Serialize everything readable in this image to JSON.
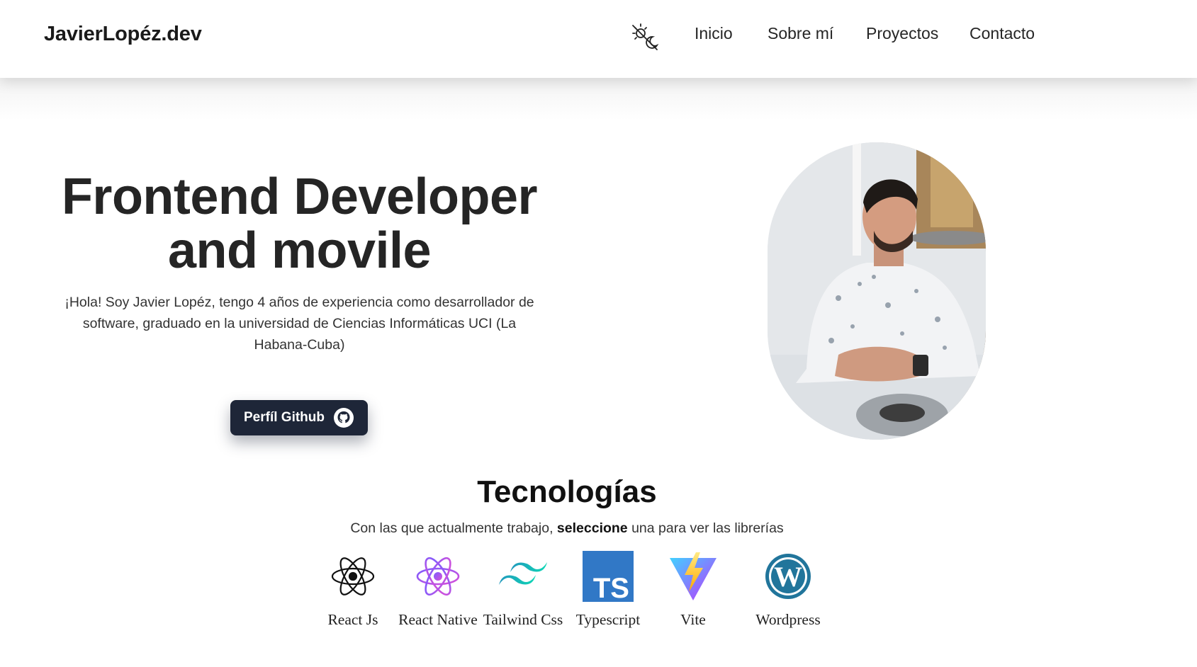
{
  "header": {
    "logo": "JavierLopéz.dev",
    "nav": [
      {
        "label": "Inicio"
      },
      {
        "label": "Sobre mí"
      },
      {
        "label": "Proyectos"
      },
      {
        "label": "Contacto"
      }
    ]
  },
  "hero": {
    "title_line1": "Frontend Developer",
    "title_line2": "and movile",
    "description": "¡Hola! Soy Javier Lopéz, tengo 4 años de experiencia como desarrollador de software, graduado en la universidad de Ciencias Informáticas UCI (La Habana-Cuba)",
    "github_button": "Perfíl Github"
  },
  "technologies": {
    "title": "Tecnologías",
    "subtitle_prefix": "Con las que actualmente trabajo, ",
    "subtitle_bold": "seleccione",
    "subtitle_suffix": " una para ver las librerías",
    "items": [
      {
        "label": "React Js",
        "icon": "react-icon"
      },
      {
        "label": "React Native",
        "icon": "react-native-icon"
      },
      {
        "label": "Tailwind Css",
        "icon": "tailwind-icon"
      },
      {
        "label": "Typescript",
        "icon": "typescript-icon"
      },
      {
        "label": "Vite",
        "icon": "vite-icon"
      },
      {
        "label": "Wordpress",
        "icon": "wordpress-icon"
      }
    ]
  },
  "colors": {
    "button_bg": "#1e2638",
    "typescript_blue": "#3178c6",
    "wordpress_blue": "#21759b"
  }
}
